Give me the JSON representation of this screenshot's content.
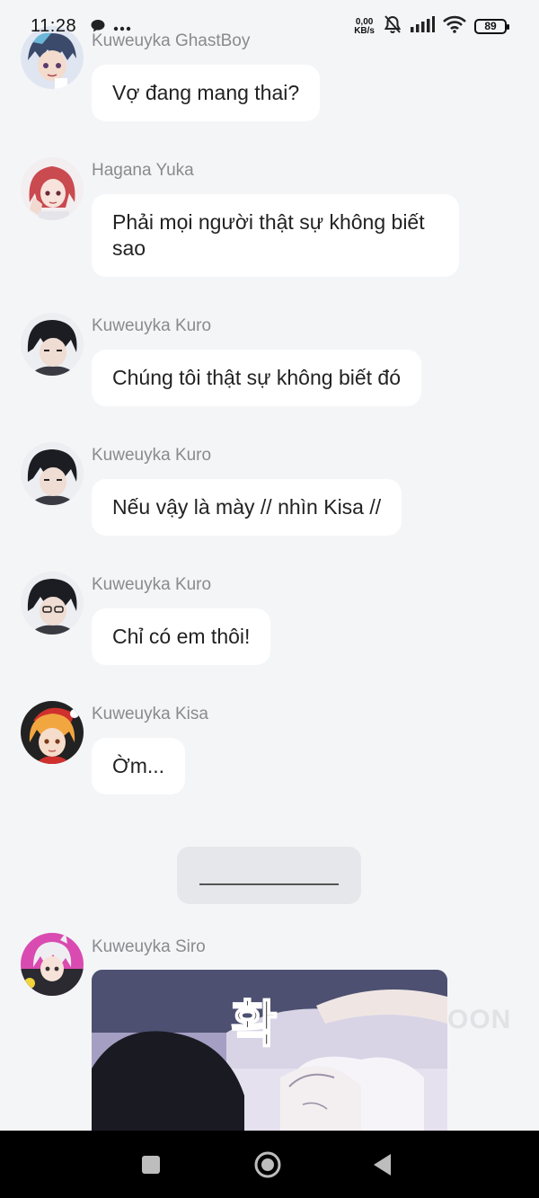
{
  "status_bar": {
    "time": "11:28",
    "net_speed_value": "0,00",
    "net_speed_unit": "KB/s",
    "battery": "89",
    "icons": [
      "chat-bubble-icon",
      "more-dots-icon",
      "bell-muted-icon",
      "signal-icon",
      "wifi-icon",
      "battery-icon"
    ]
  },
  "messages": [
    {
      "sender": "Kuweuyka GhastBoy",
      "text": "Vợ đang mang thai?"
    },
    {
      "sender": "Hagana Yuka",
      "text": "Phải mọi người thật sự không biết sao"
    },
    {
      "sender": "Kuweuyka Kuro",
      "text": "Chúng  tôi thật sự không biết đó"
    },
    {
      "sender": "Kuweuyka Kuro",
      "text": "Nếu vậy là mày // nhìn Kisa //"
    },
    {
      "sender": "Kuweuyka Kuro",
      "text": "Chỉ có em thôi!"
    },
    {
      "sender": "Kuweuyka Kisa",
      "text": "Ờm..."
    }
  ],
  "image_message": {
    "sender": "Kuweuyka Siro",
    "image_text": "확"
  },
  "watermark": "OON",
  "nav_bar": {
    "buttons": [
      "recents-button",
      "home-button",
      "back-button"
    ]
  },
  "colors": {
    "background": "#f4f5f7",
    "bubble": "#ffffff",
    "sender_name": "#8a8a8f",
    "divider_card": "#e6e7ea",
    "nav_bar": "#000000"
  }
}
